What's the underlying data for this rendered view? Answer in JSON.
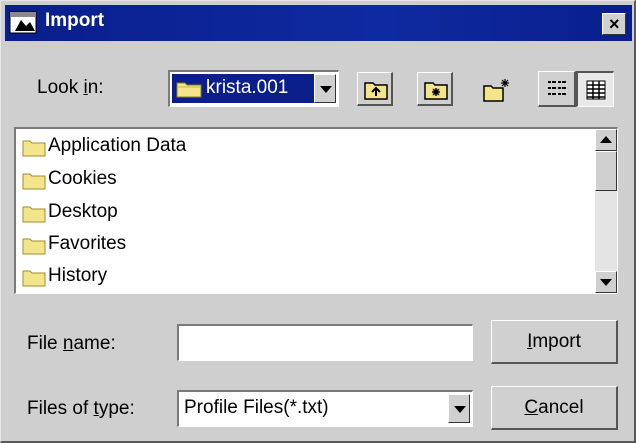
{
  "window": {
    "title": "Import",
    "close_glyph": "×",
    "icon": "app-icon"
  },
  "lookin": {
    "label_pre": "Look ",
    "label_mnem": "i",
    "label_post": "n:",
    "selected": "krista.001",
    "selected_icon": "folder-icon"
  },
  "toolbar": {
    "buttons": [
      "up-one-level-icon",
      "home-icon",
      "new-folder-icon",
      "list-view-icon",
      "details-view-icon"
    ]
  },
  "files": {
    "items": [
      {
        "name": "Application Data",
        "icon": "folder-icon"
      },
      {
        "name": "Cookies",
        "icon": "folder-icon"
      },
      {
        "name": "Desktop",
        "icon": "folder-icon"
      },
      {
        "name": "Favorites",
        "icon": "folder-icon"
      },
      {
        "name": "History",
        "icon": "folder-icon"
      }
    ]
  },
  "filename": {
    "label_pre": "File ",
    "label_mnem": "n",
    "label_post": "ame:",
    "value": ""
  },
  "filetype": {
    "label_pre": "Files of ",
    "label_mnem": "t",
    "label_post": "ype:",
    "selected": "Profile Files(*.txt)"
  },
  "actions": {
    "import_mnem": "I",
    "import_rest": "mport",
    "cancel_mnem": "C",
    "cancel_rest": "ancel"
  },
  "colors": {
    "titlebar": "#0a1e8c",
    "dialog_bg": "#cfcfcf",
    "folder": "#f5e58a"
  }
}
